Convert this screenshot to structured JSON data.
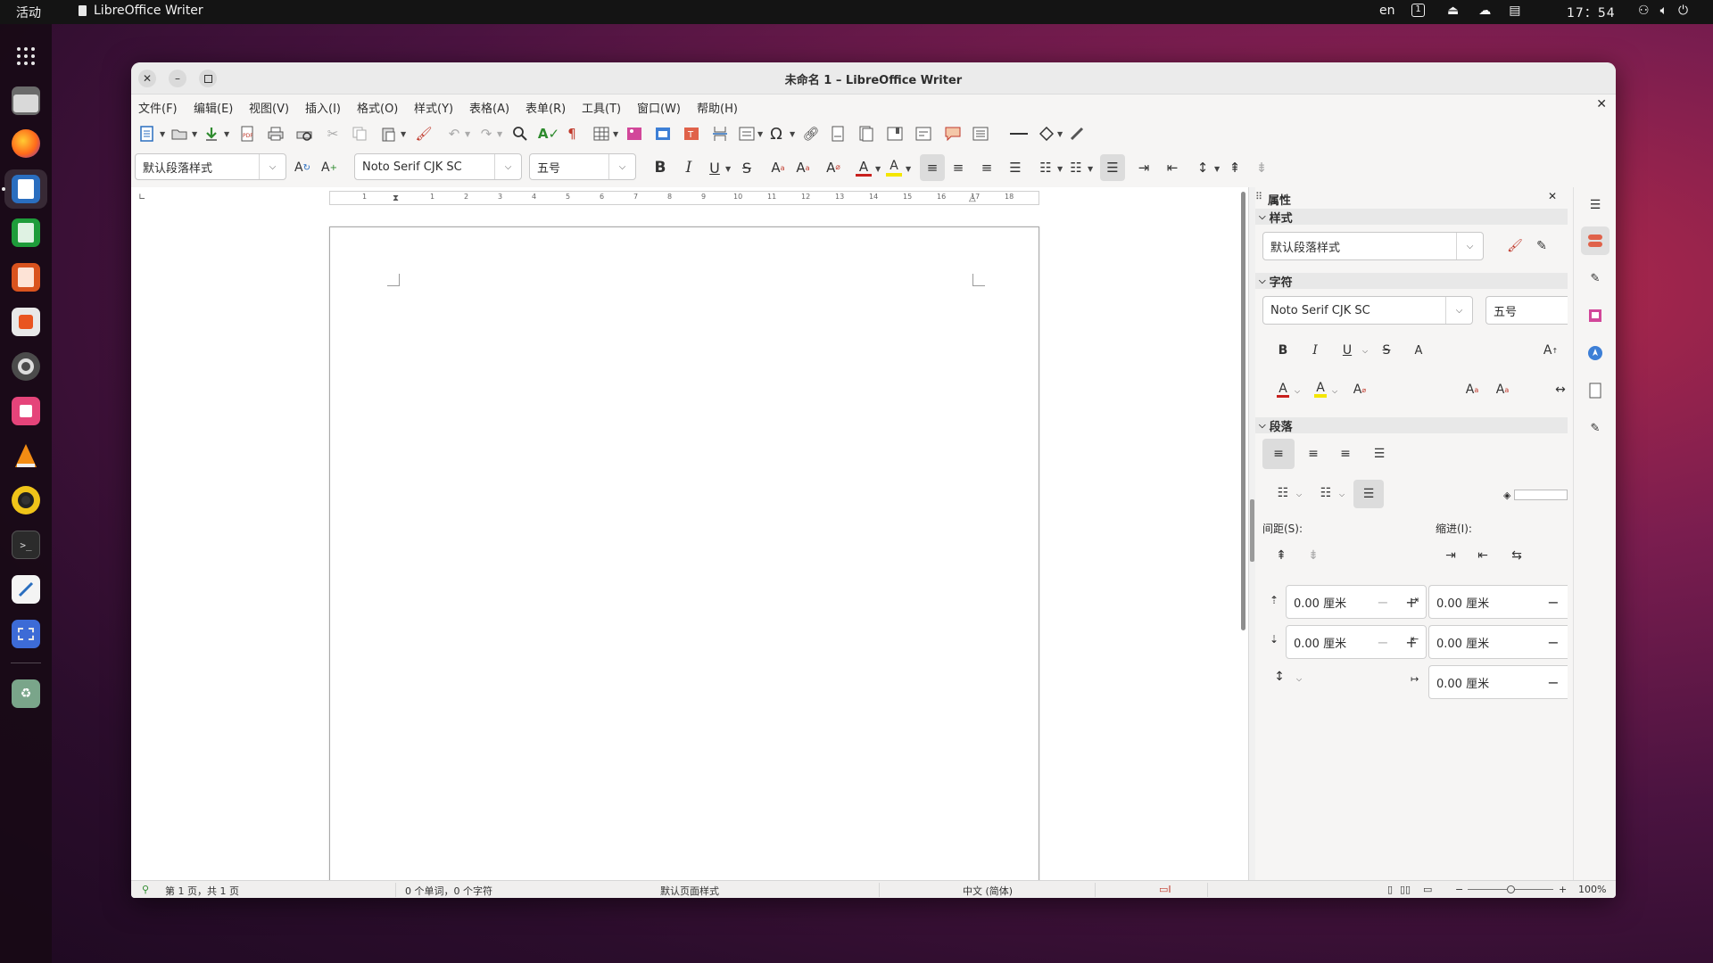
{
  "topbar": {
    "activities": "活动",
    "app_name": "LibreOffice Writer",
    "input_lang": "en",
    "workspace": "1",
    "clock": "17：54"
  },
  "dock": {
    "items": [
      "apps-grid-icon",
      "files-icon",
      "firefox-icon",
      "writer-icon",
      "calc-icon",
      "impress-icon",
      "software-icon",
      "settings-icon",
      "app-store-icon",
      "vlc-icon",
      "rhythmbox-icon",
      "terminal-icon",
      "text-editor-icon",
      "screenshot-icon",
      "trash-icon"
    ]
  },
  "window": {
    "title": "未命名 1 – LibreOffice Writer"
  },
  "menu": [
    "文件(F)",
    "编辑(E)",
    "视图(V)",
    "插入(I)",
    "格式(O)",
    "样式(Y)",
    "表格(A)",
    "表单(R)",
    "工具(T)",
    "窗口(W)",
    "帮助(H)"
  ],
  "formatting": {
    "paragraph_style": "默认段落样式",
    "font_name": "Noto Serif CJK SC",
    "font_size": "五号"
  },
  "ruler": {
    "ticks": [
      "1",
      "1",
      "2",
      "3",
      "4",
      "5",
      "6",
      "7",
      "8",
      "9",
      "10",
      "11",
      "12",
      "13",
      "14",
      "15",
      "16",
      "17",
      "18"
    ]
  },
  "sidebar": {
    "title": "属性",
    "styles_section": "样式",
    "paragraph_style": "默认段落样式",
    "character_section": "字符",
    "font_name": "Noto Serif CJK SC",
    "font_size": "五号",
    "paragraph_section": "段落",
    "spacing_label": "间距(S):",
    "indent_label": "缩进(I):",
    "above_spacing": "0.00 厘米",
    "below_spacing": "0.00 厘米",
    "before_indent": "0.00 厘米",
    "after_indent": "0.00 厘米",
    "first_line_indent": "0.00 厘米"
  },
  "status": {
    "page": "第 1 页，共 1 页",
    "words": "0 个单词，0 个字符",
    "page_style": "默认页面样式",
    "language": "中文 (简体)",
    "zoom": "100%"
  }
}
